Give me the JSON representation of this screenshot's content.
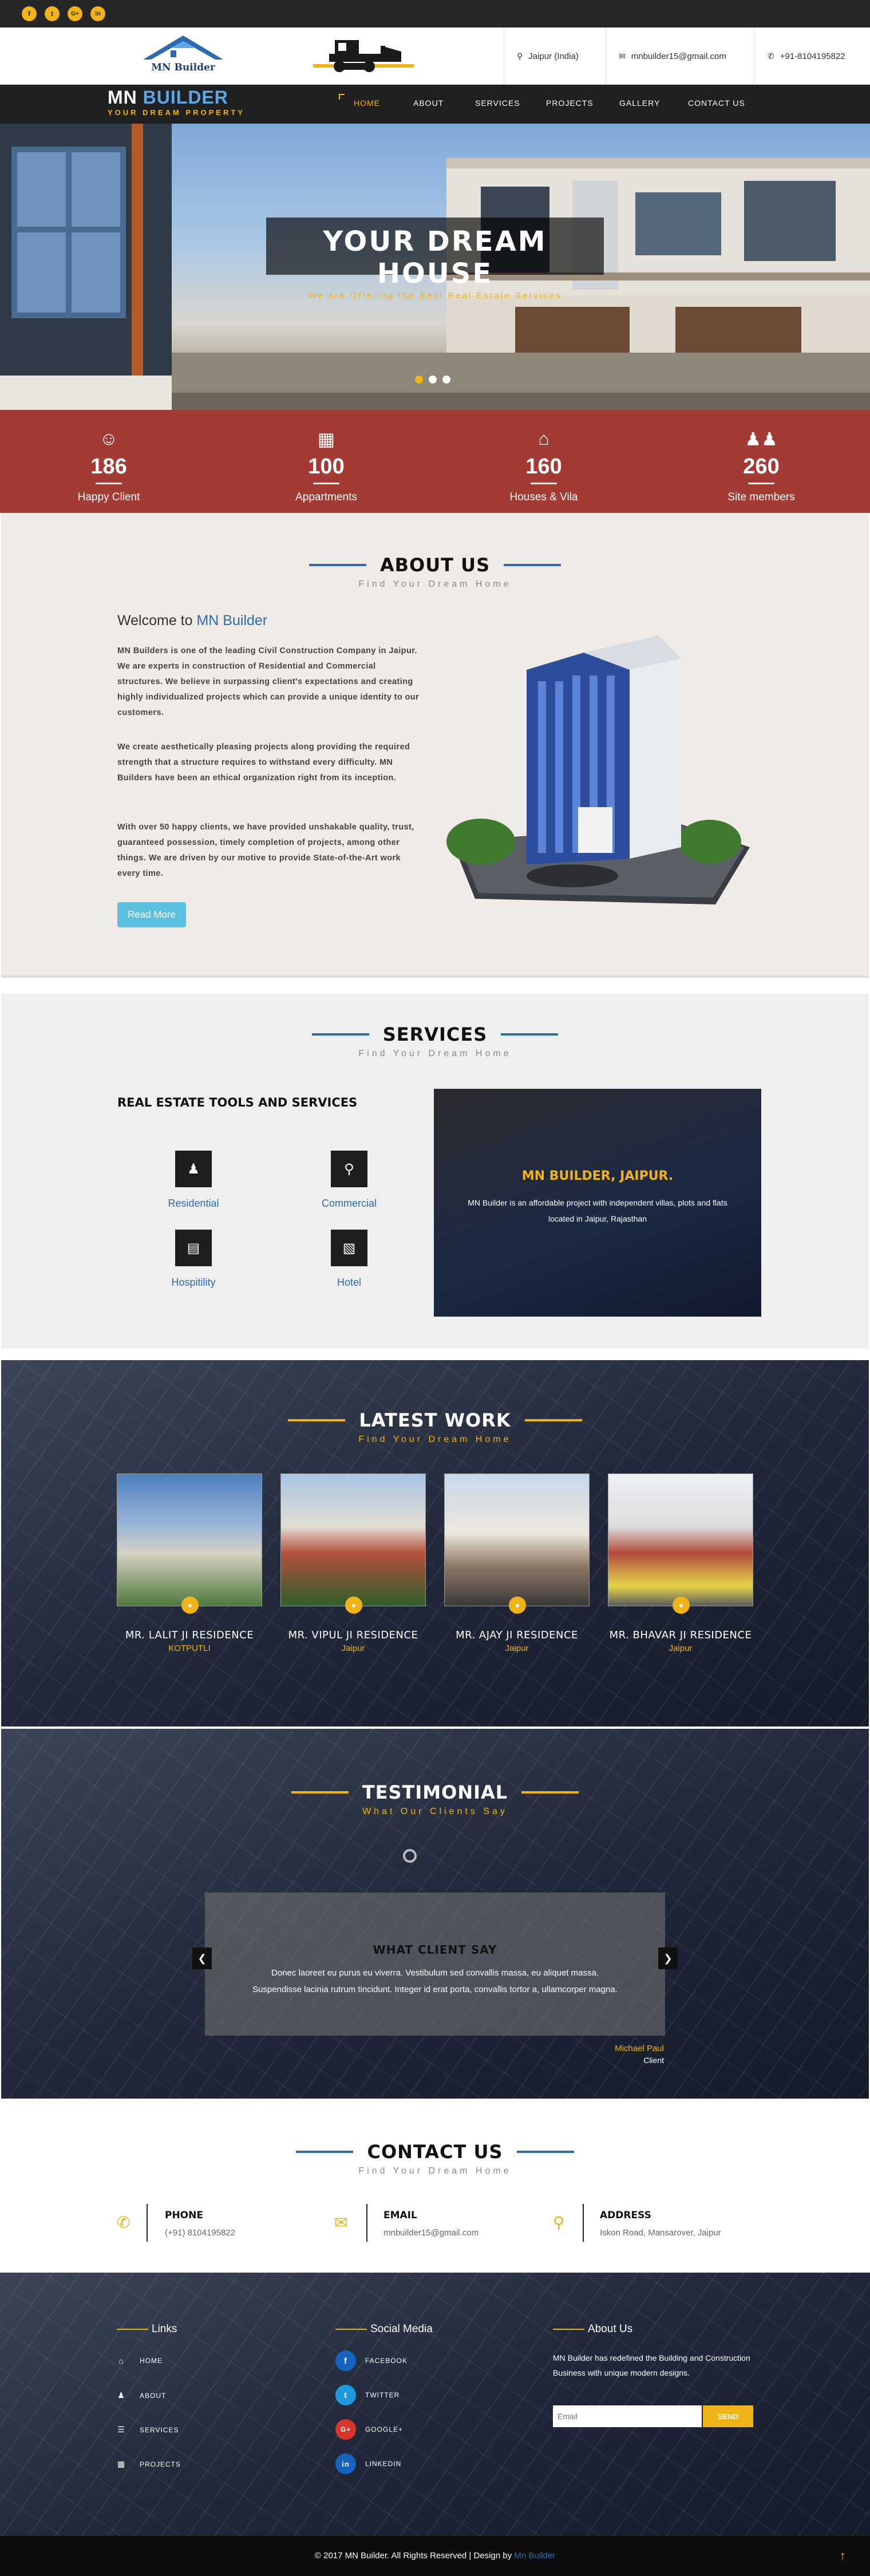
{
  "topbar": {
    "socials": [
      "f",
      "t",
      "G+",
      "in"
    ]
  },
  "header": {
    "logo_text": "MN Builder",
    "location": "Jaipur (India)",
    "email": "mnbuilder15@gmail.com",
    "phone": "+91-8104195822"
  },
  "nav": {
    "brand_1": "MN ",
    "brand_2": "BUILDER",
    "tagline": "YOUR DREAM PROPERTY",
    "items": [
      "HOME",
      "ABOUT",
      "SERVICES",
      "PROJECTS",
      "GALLERY",
      "CONTACT US"
    ]
  },
  "hero": {
    "title": "YOUR DREAM HOUSE",
    "subtitle": "We are Offering the Best Real Estate Services"
  },
  "stats": [
    {
      "icon": "smile-icon",
      "value": "186",
      "label": "Happy Client"
    },
    {
      "icon": "building-icon",
      "value": "100",
      "label": "Appartments"
    },
    {
      "icon": "home-icon",
      "value": "160",
      "label": "Houses & Vila"
    },
    {
      "icon": "users-icon",
      "value": "260",
      "label": "Site members"
    }
  ],
  "about": {
    "title": "ABOUT US",
    "subtitle": "Find Your Dream Home",
    "welcome_1": "Welcome to ",
    "welcome_2": "MN Builder",
    "p1": "MN Builders is one of the leading Civil Construction Company in Jaipur. We are experts in construction of Residential and Commercial structures. We believe in surpassing client's expectations and creating highly individualized projects which can provide a unique identity to our customers.",
    "p2": "We create aesthetically pleasing projects along providing the required strength that a structure requires to withstand every difficulty. MN Builders have been an ethical organization right from its inception.",
    "p3": "With over 50 happy clients, we have provided unshakable quality, trust, guaranteed possession, timely completion of projects, among other things. We are driven by our motive to provide State-of-the-Art work every time.",
    "button": "Read More"
  },
  "services": {
    "title": "SERVICES",
    "subtitle": "Find Your Dream Home",
    "heading": "REAL ESTATE TOOLS AND SERVICES",
    "items": [
      "Residential",
      "Commercial",
      "Hospitility",
      "Hotel"
    ],
    "panel_title": "MN BUILDER, JAIPUR.",
    "panel_text": "MN Builder is an affordable project with independent villas, plots and flats located in Jaipur, Rajasthan"
  },
  "work": {
    "title": "LATEST WORK",
    "subtitle": "Find Your Dream Home",
    "items": [
      {
        "name": "MR. LALIT JI RESIDENCE",
        "loc": "KOTPUTLI"
      },
      {
        "name": "MR. VIPUL JI RESIDENCE",
        "loc": "Jaipur"
      },
      {
        "name": "MR. AJAY JI RESIDENCE",
        "loc": "Jaipur"
      },
      {
        "name": "MR. BHAVAR JI RESIDENCE",
        "loc": "Jaipur"
      }
    ]
  },
  "testimonial": {
    "title": "TESTIMONIAL",
    "subtitle": "What Our Clients Say",
    "box_title": "WHAT CLIENT SAY",
    "text": "Donec laoreet eu purus eu viverra. Vestibulum sed convallis massa, eu aliquet massa. Suspendisse lacinia rutrum tincidunt. Integer id erat porta, convallis tortor a, ullamcorper magna.",
    "author": "Michael Paul",
    "role": "Client"
  },
  "contact": {
    "title": "CONTACT US",
    "subtitle": "Find Your Dream Home",
    "phone_label": "PHONE",
    "phone": "(+91) 8104195822",
    "email_label": "EMAIL",
    "email": "mnbuilder15@gmail.com",
    "address_label": "ADDRESS",
    "address": "Iskon Road, Mansarover, Jaipur"
  },
  "footer": {
    "links_title": "Links",
    "links": [
      "HOME",
      "ABOUT",
      "SERVICES",
      "PROJECTS"
    ],
    "social_title": "Social Media",
    "socials": [
      "FACEBOOK",
      "TWITTER",
      "GOOGLE+",
      "LINKEDIN"
    ],
    "about_title": "About Us",
    "about_text": "MN Builder has redefined the Building and Construction Business with unique modern designs.",
    "email_placeholder": "Email",
    "send": "SEND",
    "copyright": "© 2017 MN Builder. All Rights Reserved | Design by ",
    "designer": "Mn Builder"
  },
  "colors": {
    "accent": "#f0b419",
    "brand_blue": "#2c6bb0",
    "stats_red": "#a33a33",
    "dark": "#202020"
  }
}
